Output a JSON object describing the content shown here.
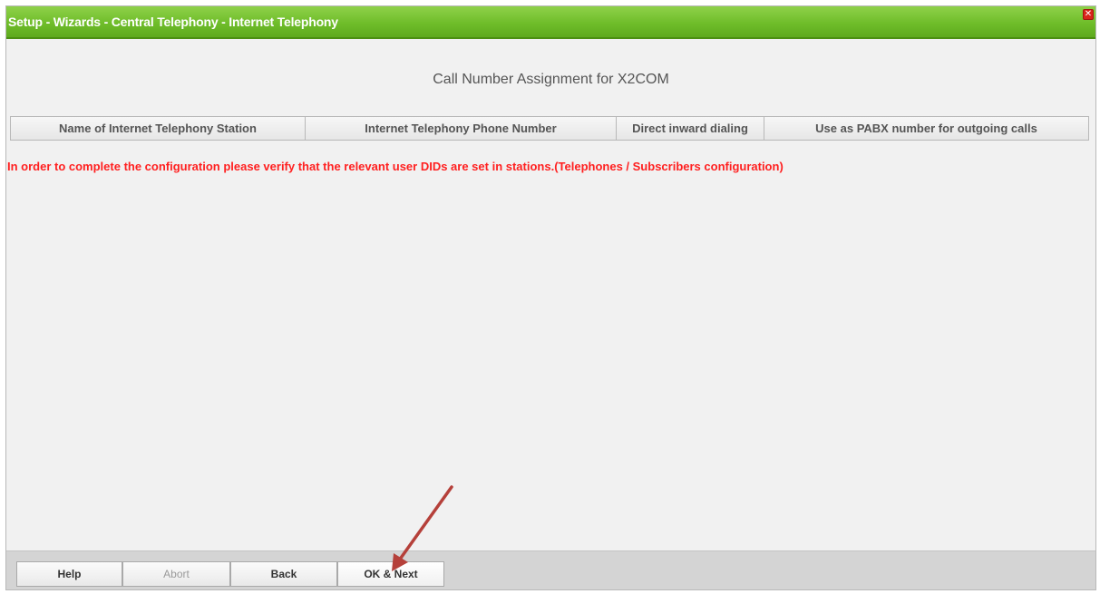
{
  "window": {
    "title": "Setup - Wizards - Central Telephony - Internet Telephony",
    "close_icon": "close-icon",
    "title_bar_color": "#6fbd2a"
  },
  "main": {
    "heading": "Call Number Assignment for X2COM",
    "table": {
      "columns": [
        "Name of Internet Telephony Station",
        "Internet Telephony Phone Number",
        "Direct inward dialing",
        "Use as PABX number for outgoing calls"
      ],
      "rows": []
    },
    "warning": "In order to complete the configuration please verify that the relevant user DIDs are set in stations.(Telephones / Subscribers configuration)",
    "warning_color": "#ff2020"
  },
  "footer": {
    "help": "Help",
    "abort": "Abort",
    "back": "Back",
    "ok_next": "OK & Next"
  },
  "annotation": {
    "arrow_icon": "arrow-icon",
    "arrow_color": "#b5403a"
  }
}
